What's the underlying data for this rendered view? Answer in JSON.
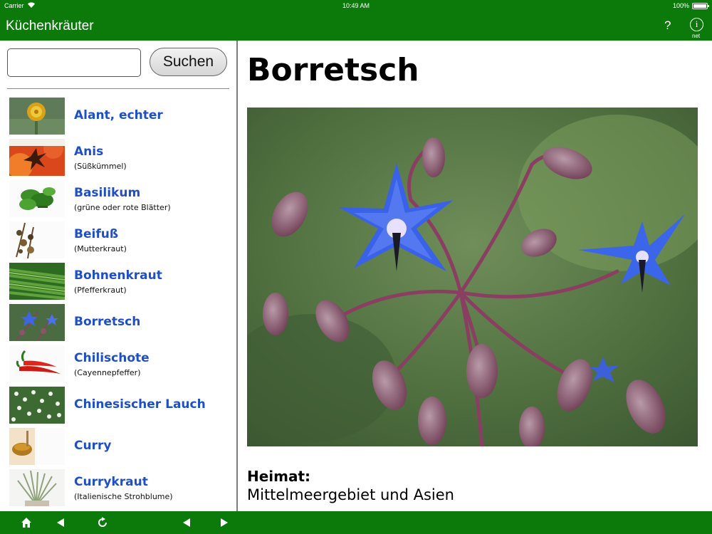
{
  "status_bar": {
    "carrier": "Carrier",
    "time": "10:49 AM",
    "battery": "100%"
  },
  "nav_bar": {
    "title": "Küchenkräuter",
    "help_label": "?",
    "info_label": "i",
    "info_sublabel": "net"
  },
  "search": {
    "value": "",
    "placeholder": "",
    "button_label": "Suchen"
  },
  "herbs": [
    {
      "name": "Alant, echter",
      "subtitle": ""
    },
    {
      "name": "Anis",
      "subtitle": "(Süßkümmel)"
    },
    {
      "name": "Basilikum",
      "subtitle": "(grüne oder rote Blätter)"
    },
    {
      "name": "Beifuß",
      "subtitle": "(Mutterkraut)"
    },
    {
      "name": "Bohnenkraut",
      "subtitle": "(Pfefferkraut)"
    },
    {
      "name": "Borretsch",
      "subtitle": ""
    },
    {
      "name": "Chilischote",
      "subtitle": "(Cayennepfeffer)"
    },
    {
      "name": "Chinesischer Lauch",
      "subtitle": ""
    },
    {
      "name": "Curry",
      "subtitle": ""
    },
    {
      "name": "Currykraut",
      "subtitle": "(Italienische Strohblume)"
    }
  ],
  "detail": {
    "title": "Borretsch",
    "section_label": "Heimat:",
    "section_value": "Mittelmeergebiet und Asien"
  },
  "colors": {
    "bar_green": "#0b7a0b",
    "link_blue": "#1f4fc4"
  },
  "toolbar_icons": [
    "home-icon",
    "back-arrow-icon",
    "reload-icon",
    "previous-icon",
    "next-icon"
  ]
}
